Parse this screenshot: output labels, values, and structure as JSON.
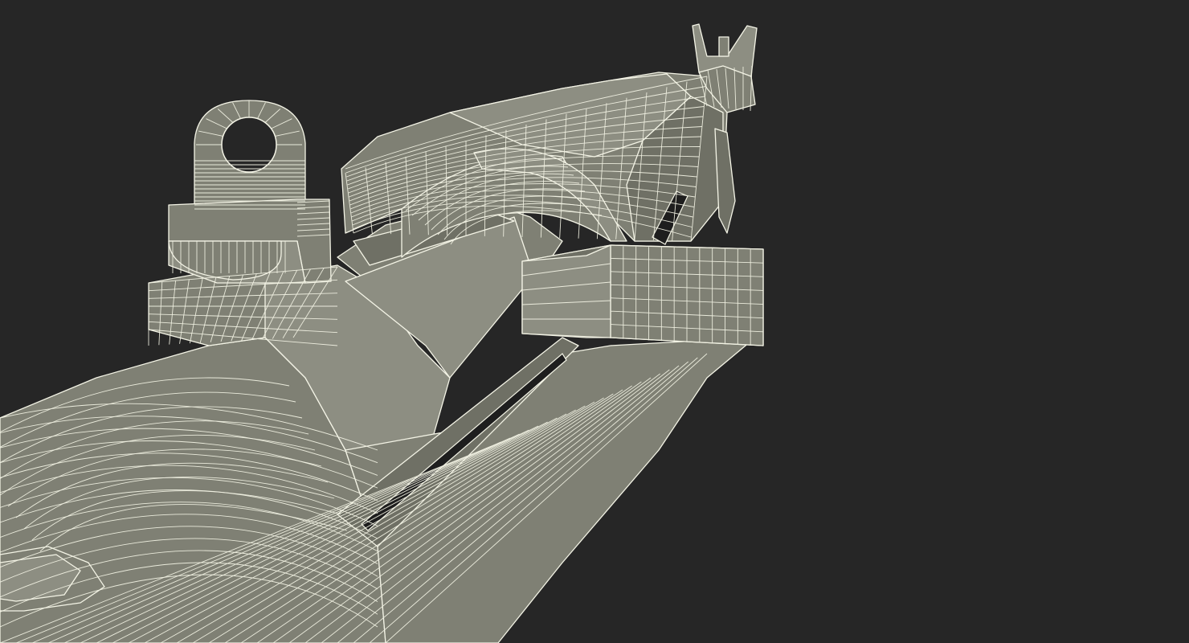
{
  "scene": {
    "subject": "rifle-wireframe-render",
    "colors": {
      "background": "#262626",
      "surface": "#7f8074",
      "wireframe": "#f4f4e6"
    }
  }
}
